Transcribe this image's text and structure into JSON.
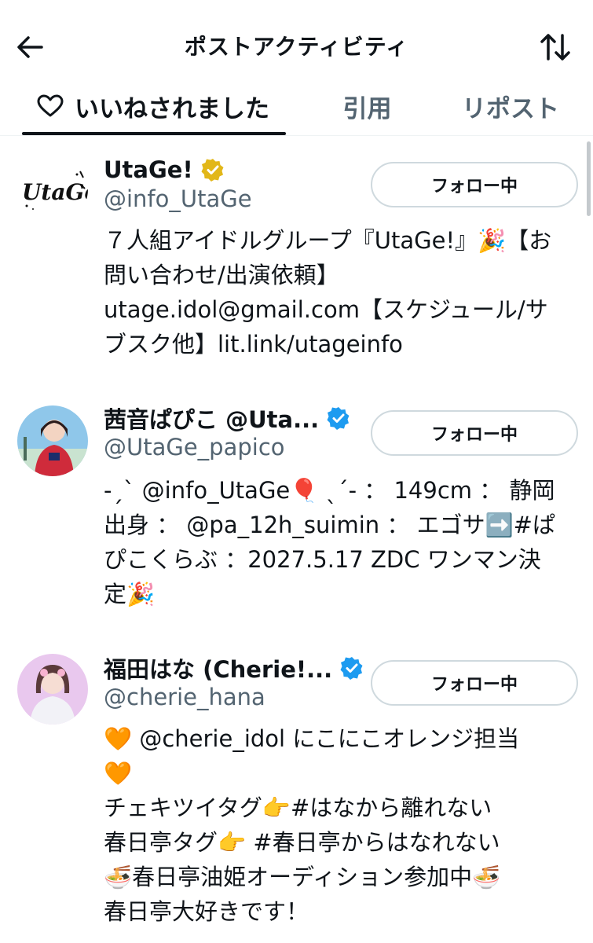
{
  "header": {
    "title": "ポストアクティビティ",
    "back_icon": "arrow-left-icon",
    "sort_icon": "sort-arrows-icon"
  },
  "tabs": [
    {
      "label": "いいねされました",
      "icon": "heart-outline-icon",
      "active": true
    },
    {
      "label": "引用",
      "active": false
    },
    {
      "label": "リポスト",
      "active": false
    }
  ],
  "users": [
    {
      "name": "UtaGe!",
      "verified": "gold",
      "handle": "@info_UtaGe",
      "follow_label": "フォロー中",
      "bio_lines": [
        "７人組アイドルグループ『UtaGe!』🎉【お",
        "問い合わせ/出演依頼】",
        "utage.idol@gmail.com【スケジュール/サ",
        "ブスク他】lit.link/utageinfo"
      ]
    },
    {
      "name": "茜音ぱぴこ @Uta...",
      "verified": "blue",
      "handle": "@UtaGe_papico",
      "follow_label": "フォロー中",
      "bio_lines": [
        "-ˏˋ @info_UtaGe🎈 ˎˊ- ： 149cm ： 静岡",
        "出身 ： @pa_12h_suimin ： エゴサ➡️#ぱ",
        "ぴこくらぶ ：2027.5.17 ZDC ワンマン決",
        "定🎉"
      ]
    },
    {
      "name": "福田はな (Cherie!...",
      "verified": "blue",
      "handle": "@cherie_hana",
      "follow_label": "フォロー中",
      "bio_lines": [
        "🧡 @cherie_idol にこにこオレンジ担当",
        "🧡",
        "チェキツイタグ👉#はなから離れない",
        "春日亭タグ👉 #春日亭からはなれない",
        "🍜春日亭油姫オーディション参加中🍜",
        "春日亭大好きです！"
      ]
    }
  ],
  "colors": {
    "text": "#0f1419",
    "secondary": "#536471",
    "verified_blue": "#1d9bf0",
    "verified_gold": "#e2b719",
    "border": "#cfd9de"
  }
}
